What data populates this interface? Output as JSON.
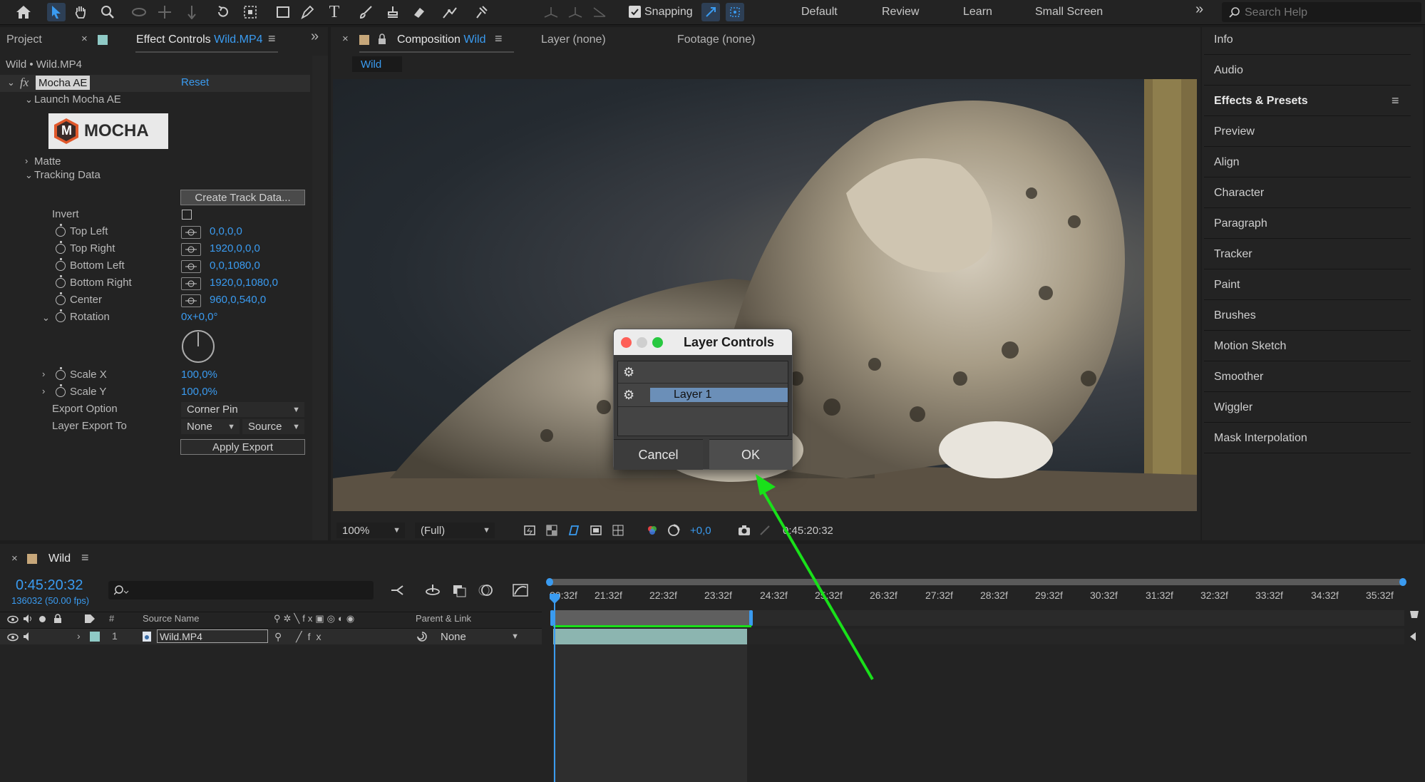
{
  "toolbar": {
    "snapping_label": "Snapping",
    "workspaces": [
      "Default",
      "Review",
      "Learn",
      "Small Screen"
    ],
    "search_placeholder": "Search Help"
  },
  "left_panel": {
    "tabs": {
      "project": "Project",
      "effect_controls": "Effect Controls",
      "effect_controls_file": "Wild.MP4"
    },
    "breadcrumb": "Wild • Wild.MP4",
    "effect": {
      "name": "Mocha AE",
      "reset": "Reset",
      "launch": "Launch Mocha AE",
      "logo_letter": "M",
      "logo_text": "MOCHA"
    },
    "sections": {
      "matte": "Matte",
      "tracking_data": "Tracking Data"
    },
    "create_track_data": "Create Track Data...",
    "invert": "Invert",
    "props": [
      {
        "label": "Top Left",
        "value": "0,0,0,0"
      },
      {
        "label": "Top Right",
        "value": "1920,0,0,0"
      },
      {
        "label": "Bottom Left",
        "value": "0,0,1080,0"
      },
      {
        "label": "Bottom Right",
        "value": "1920,0,1080,0"
      },
      {
        "label": "Center",
        "value": "960,0,540,0"
      }
    ],
    "rotation": {
      "label": "Rotation",
      "value": "0x+0,0°"
    },
    "scale_x": {
      "label": "Scale X",
      "value": "100,0%"
    },
    "scale_y": {
      "label": "Scale Y",
      "value": "100,0%"
    },
    "export_option": {
      "label": "Export Option",
      "value": "Corner Pin"
    },
    "layer_export_to": {
      "label": "Layer Export To",
      "value1": "None",
      "value2": "Source"
    },
    "apply_export": "Apply Export"
  },
  "comp_panel": {
    "tab_label": "Composition",
    "comp_name": "Wild",
    "layer_tab": "Layer (none)",
    "footage_tab": "Footage (none)",
    "subtab": "Wild",
    "zoom": "100%",
    "resolution": "(Full)",
    "exposure": "+0,0",
    "timecode": "0:45:20:32"
  },
  "dialog": {
    "title": "Layer Controls",
    "layer_item": "Layer 1",
    "cancel": "Cancel",
    "ok": "OK"
  },
  "right_panel": {
    "items": [
      "Info",
      "Audio",
      "Effects & Presets",
      "Preview",
      "Align",
      "Character",
      "Paragraph",
      "Tracker",
      "Paint",
      "Brushes",
      "Motion Sketch",
      "Smoother",
      "Wiggler",
      "Mask Interpolation"
    ]
  },
  "timeline": {
    "tab": "Wild",
    "timecode": "0:45:20:32",
    "frames": "136032 (50.00 fps)",
    "col_num": "#",
    "col_source": "Source Name",
    "col_parent": "Parent & Link",
    "layer_num": "1",
    "layer_name": "Wild.MP4",
    "parent_value": "None",
    "ticks": [
      "20:32f",
      "21:32f",
      "22:32f",
      "23:32f",
      "24:32f",
      "25:32f",
      "26:32f",
      "27:32f",
      "28:32f",
      "29:32f",
      "30:32f",
      "31:32f",
      "32:32f",
      "33:32f",
      "34:32f",
      "35:32f"
    ]
  },
  "colors": {
    "accent": "#3a9bf0",
    "arrow": "#19e01a",
    "panel": "#232323",
    "label_teal": "#8fcac6"
  }
}
